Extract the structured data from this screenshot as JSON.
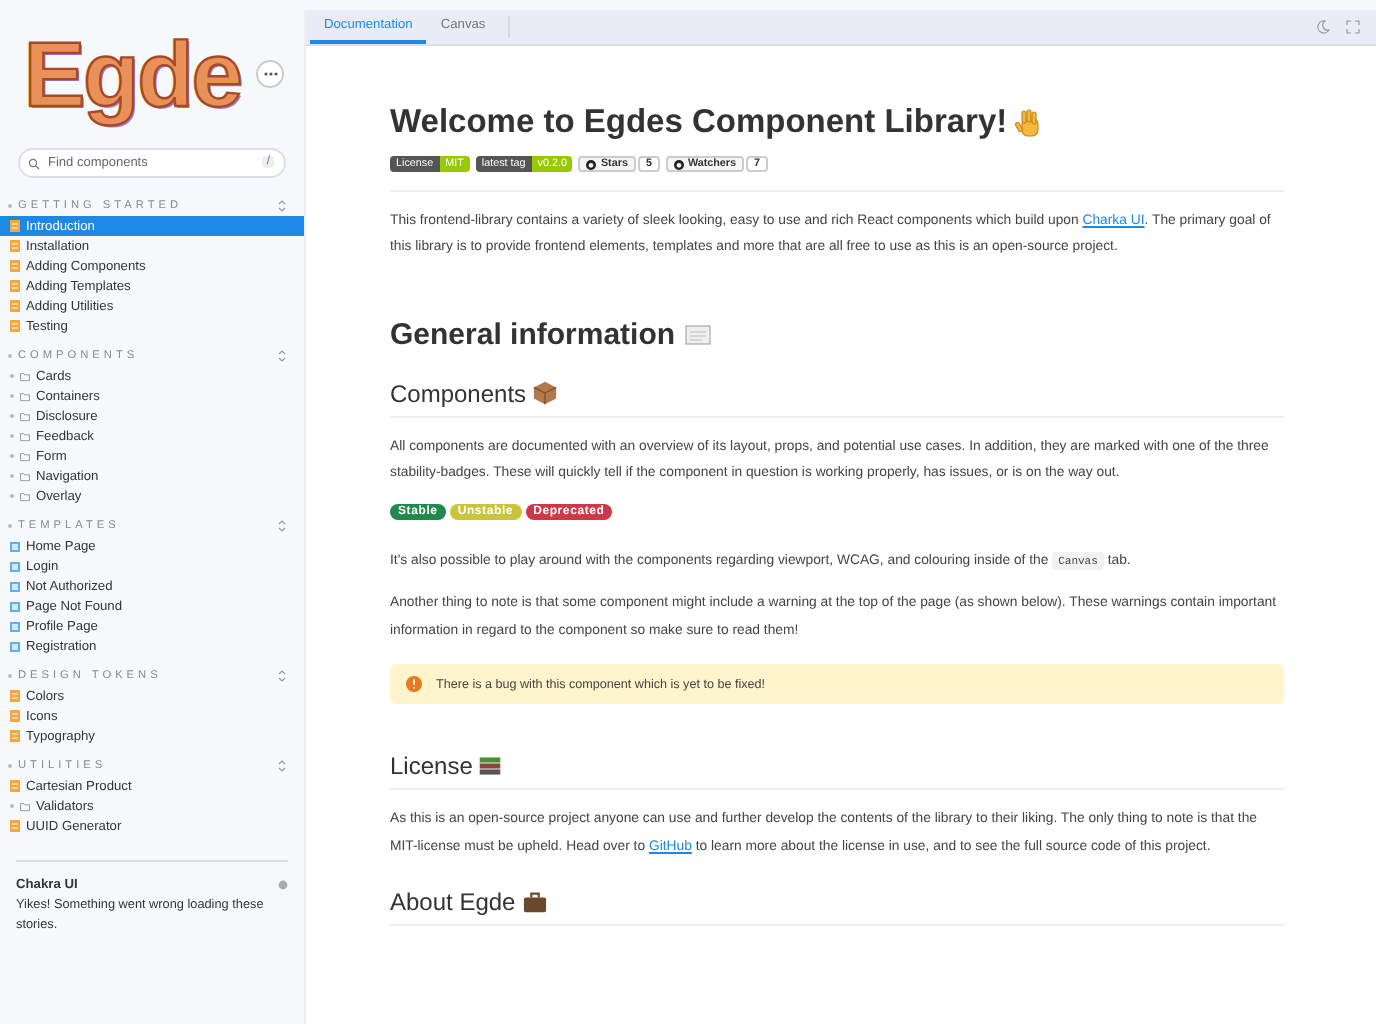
{
  "sidebar": {
    "logo": "Egde",
    "search": {
      "placeholder": "Find components",
      "shortcut": "/"
    },
    "sections": [
      {
        "title": "GETTING STARTED",
        "items": [
          {
            "label": "Introduction",
            "kind": "doc",
            "selected": true
          },
          {
            "label": "Installation",
            "kind": "doc",
            "selected": false
          },
          {
            "label": "Adding Components",
            "kind": "doc",
            "selected": false
          },
          {
            "label": "Adding Templates",
            "kind": "doc",
            "selected": false
          },
          {
            "label": "Adding Utilities",
            "kind": "doc",
            "selected": false
          },
          {
            "label": "Testing",
            "kind": "doc",
            "selected": false
          }
        ]
      },
      {
        "title": "COMPONENTS",
        "items": [
          {
            "label": "Cards",
            "kind": "folder",
            "selected": false
          },
          {
            "label": "Containers",
            "kind": "folder",
            "selected": false
          },
          {
            "label": "Disclosure",
            "kind": "folder",
            "selected": false
          },
          {
            "label": "Feedback",
            "kind": "folder",
            "selected": false
          },
          {
            "label": "Form",
            "kind": "folder",
            "selected": false
          },
          {
            "label": "Navigation",
            "kind": "folder",
            "selected": false
          },
          {
            "label": "Overlay",
            "kind": "folder",
            "selected": false
          }
        ]
      },
      {
        "title": "TEMPLATES",
        "items": [
          {
            "label": "Home Page",
            "kind": "component",
            "selected": false
          },
          {
            "label": "Login",
            "kind": "component",
            "selected": false
          },
          {
            "label": "Not Authorized",
            "kind": "component",
            "selected": false
          },
          {
            "label": "Page Not Found",
            "kind": "component",
            "selected": false
          },
          {
            "label": "Profile Page",
            "kind": "component",
            "selected": false
          },
          {
            "label": "Registration",
            "kind": "component",
            "selected": false
          }
        ]
      },
      {
        "title": "DESIGN TOKENS",
        "items": [
          {
            "label": "Colors",
            "kind": "doc",
            "selected": false
          },
          {
            "label": "Icons",
            "kind": "doc",
            "selected": false
          },
          {
            "label": "Typography",
            "kind": "doc",
            "selected": false
          }
        ]
      },
      {
        "title": "UTILITIES",
        "items": [
          {
            "label": "Cartesian Product",
            "kind": "doc",
            "selected": false
          },
          {
            "label": "Validators",
            "kind": "folder",
            "selected": false
          },
          {
            "label": "UUID Generator",
            "kind": "doc",
            "selected": false
          }
        ]
      }
    ],
    "refs": {
      "title": "Chakra UI",
      "message": "Yikes! Something went wrong loading these stories."
    }
  },
  "tabs": [
    {
      "label": "Documentation",
      "selected": true
    },
    {
      "label": "Canvas",
      "selected": false
    }
  ],
  "content": {
    "title": "Welcome to Egdes Component Library!",
    "badges": [
      {
        "kind": "shield",
        "label": "License",
        "value": "MIT"
      },
      {
        "kind": "shield",
        "label": "latest tag",
        "value": "v0.2.0"
      },
      {
        "kind": "github",
        "label": "Stars",
        "value": "5"
      },
      {
        "kind": "github",
        "label": "Watchers",
        "value": "7"
      }
    ],
    "blocks": [
      {
        "kind": "p",
        "parts": [
          {
            "kind": "text",
            "text": "This frontend-library contains a variety of sleek looking, easy to use and rich React components which build upon "
          },
          {
            "kind": "link",
            "text": "Charka UI"
          },
          {
            "kind": "text",
            "text": ". The primary goal of this library is to provide frontend elements, templates and more that are all free to use as this is an open-source project."
          }
        ]
      },
      {
        "kind": "h2",
        "text": "General information"
      },
      {
        "kind": "h3",
        "text": "Components"
      },
      {
        "kind": "p",
        "parts": [
          {
            "kind": "text",
            "text": "All components are documented with an overview of its layout, props, and potential use cases. In addition, they are marked with one of the three stability-badges. These will quickly tell if the component in question is working properly, has issues, or is on the way out."
          }
        ]
      },
      {
        "kind": "pills",
        "items": [
          {
            "label": "Stable",
            "color": "#1f8a4c"
          },
          {
            "label": "Unstable",
            "color": "#c9c43a"
          },
          {
            "label": "Deprecated",
            "color": "#d0384a"
          }
        ]
      },
      {
        "kind": "p",
        "parts": [
          {
            "kind": "text",
            "text": "It's also possible to play around with the components regarding viewport, WCAG, and colouring inside of the "
          },
          {
            "kind": "code",
            "text": "Canvas"
          },
          {
            "kind": "text",
            "text": " tab."
          }
        ]
      },
      {
        "kind": "p",
        "parts": [
          {
            "kind": "text",
            "text": "Another thing to note is that some component might include a warning at the top of the page (as shown below). These warnings contain important information in regard to the component so make sure to read them!"
          }
        ]
      },
      {
        "kind": "warning",
        "text": "There is a bug with this component which is yet to be fixed!"
      },
      {
        "kind": "h3",
        "text": "License"
      },
      {
        "kind": "p",
        "parts": [
          {
            "kind": "text",
            "text": "As this is an open-source project anyone can use and further develop the contents of the library to their liking. The only thing to note is that the MIT-license must be upheld. Head over to "
          },
          {
            "kind": "link",
            "text": "GitHub"
          },
          {
            "kind": "text",
            "text": " to learn more about the license in use, and to see the full source code of this project."
          }
        ]
      },
      {
        "kind": "h3",
        "text": "About Egde"
      }
    ]
  }
}
